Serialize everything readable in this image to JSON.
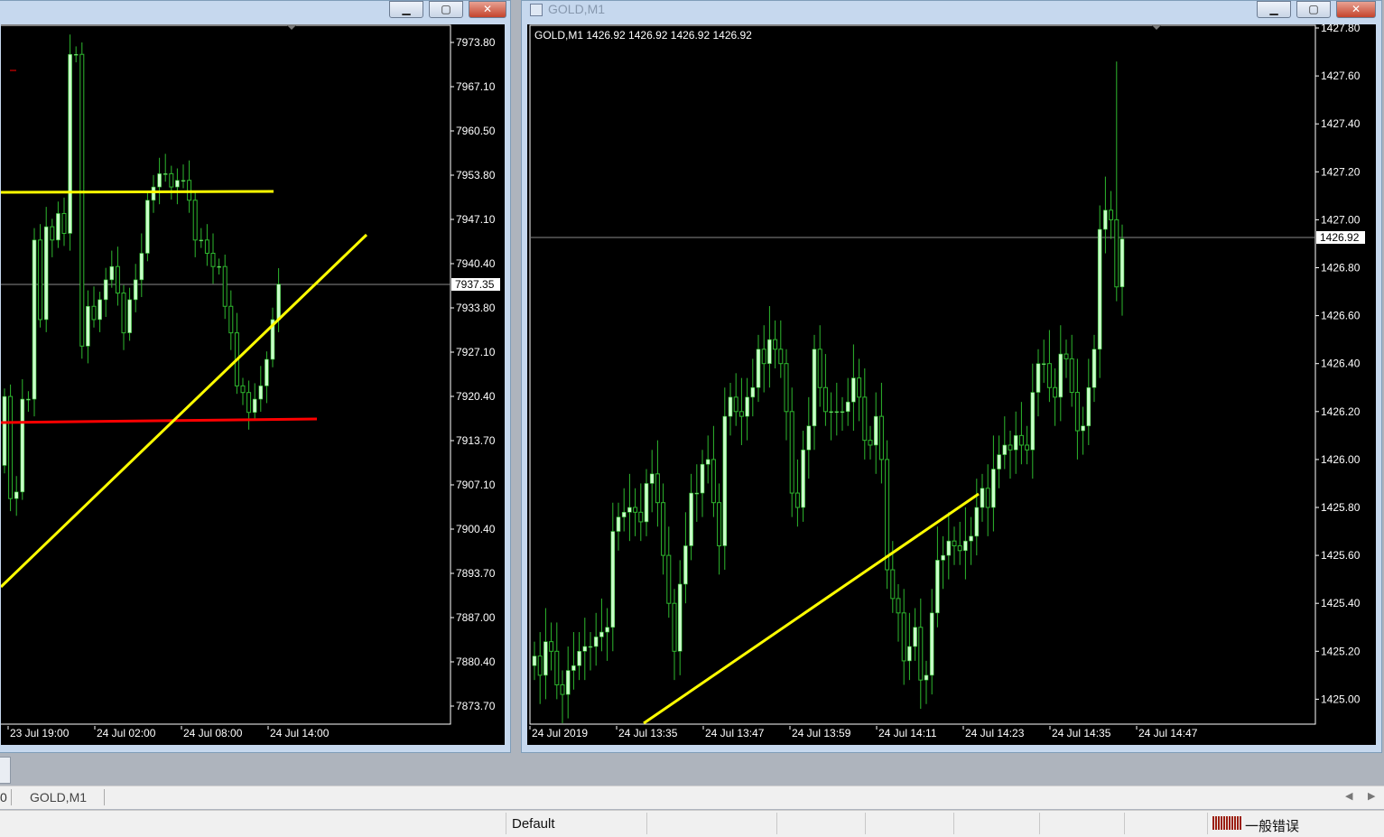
{
  "left_chart": {
    "price_labels": [
      "7973.80",
      "7967.10",
      "7960.50",
      "7953.80",
      "7947.10",
      "7940.40",
      "7933.80",
      "7927.10",
      "7920.40",
      "7913.70",
      "7907.10",
      "7900.40",
      "7893.70",
      "7887.00",
      "7880.40",
      "7873.70"
    ],
    "current_price": "7937.35",
    "time_labels": [
      "23 Jul 19:00",
      "24 Jul 02:00",
      "24 Jul 08:00",
      "24 Jul 14:00"
    ]
  },
  "right_window": {
    "title": "GOLD,M1",
    "legend": "GOLD,M1  1426.92 1426.92 1426.92 1426.92",
    "price_labels": [
      "1427.80",
      "1427.60",
      "1427.40",
      "1427.20",
      "1427.00",
      "1426.80",
      "1426.60",
      "1426.40",
      "1426.20",
      "1426.00",
      "1425.80",
      "1425.60",
      "1425.40",
      "1425.20",
      "1425.00"
    ],
    "current_price": "1426.92",
    "time_labels": [
      "24 Jul 2019",
      "24 Jul 13:35",
      "24 Jul 13:47",
      "24 Jul 13:59",
      "24 Jul 14:11",
      "24 Jul 14:23",
      "24 Jul 14:35",
      "24 Jul 14:47"
    ]
  },
  "window_buttons": {
    "minimize": "▁",
    "maximize": "▢",
    "close": "✕"
  },
  "tabs": [
    "0",
    "GOLD,M1"
  ],
  "status": {
    "profile": "Default",
    "error": "一般错误"
  },
  "colors": {
    "bull": "#c8ffc8",
    "wick": "#2eb82e",
    "trend_yellow": "#ffff00",
    "level_red": "#ff0000"
  }
}
